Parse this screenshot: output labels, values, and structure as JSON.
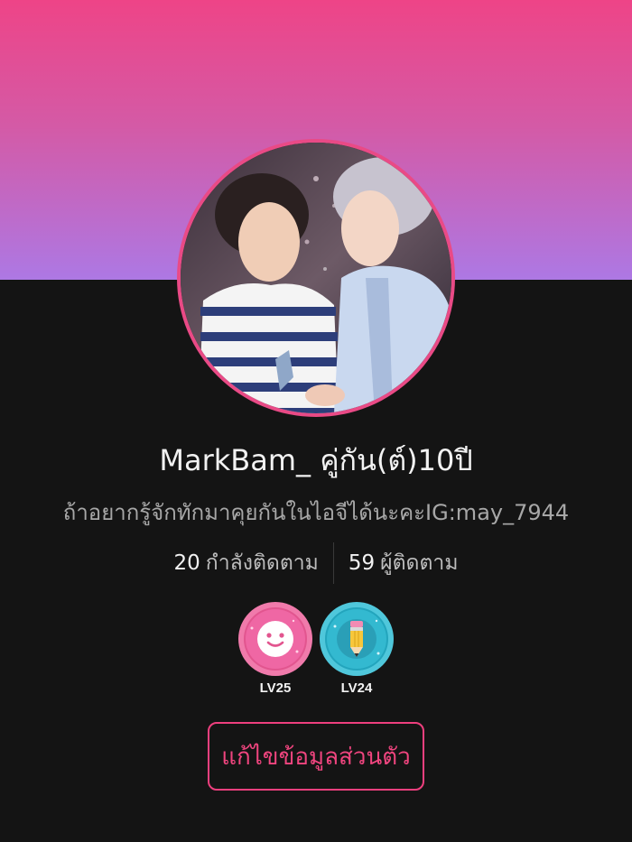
{
  "profile": {
    "display_name": "MarkBam_ คู่กัน(ต์)10ปี",
    "bio": "ถ้าอยากรู้จักทักมาคุยกันในไอจีได้นะคะIG:may_7944",
    "avatar_alt": "profile photo"
  },
  "stats": {
    "following_count": "20",
    "following_label": "กำลังติดตาม",
    "followers_count": "59",
    "followers_label": "ผู้ติดตาม"
  },
  "badges": [
    {
      "icon": "smiley-face-icon",
      "level": "LV25",
      "color": "#ef67a4"
    },
    {
      "icon": "pencil-icon",
      "level": "LV24",
      "color": "#33b9d0"
    }
  ],
  "actions": {
    "edit_profile_label": "แก้ไขข้อมูลส่วนตัว"
  },
  "colors": {
    "gradient_top": "#ee4487",
    "gradient_bottom": "#ad78e4",
    "accent": "#ee3f7e",
    "background": "#141414"
  }
}
